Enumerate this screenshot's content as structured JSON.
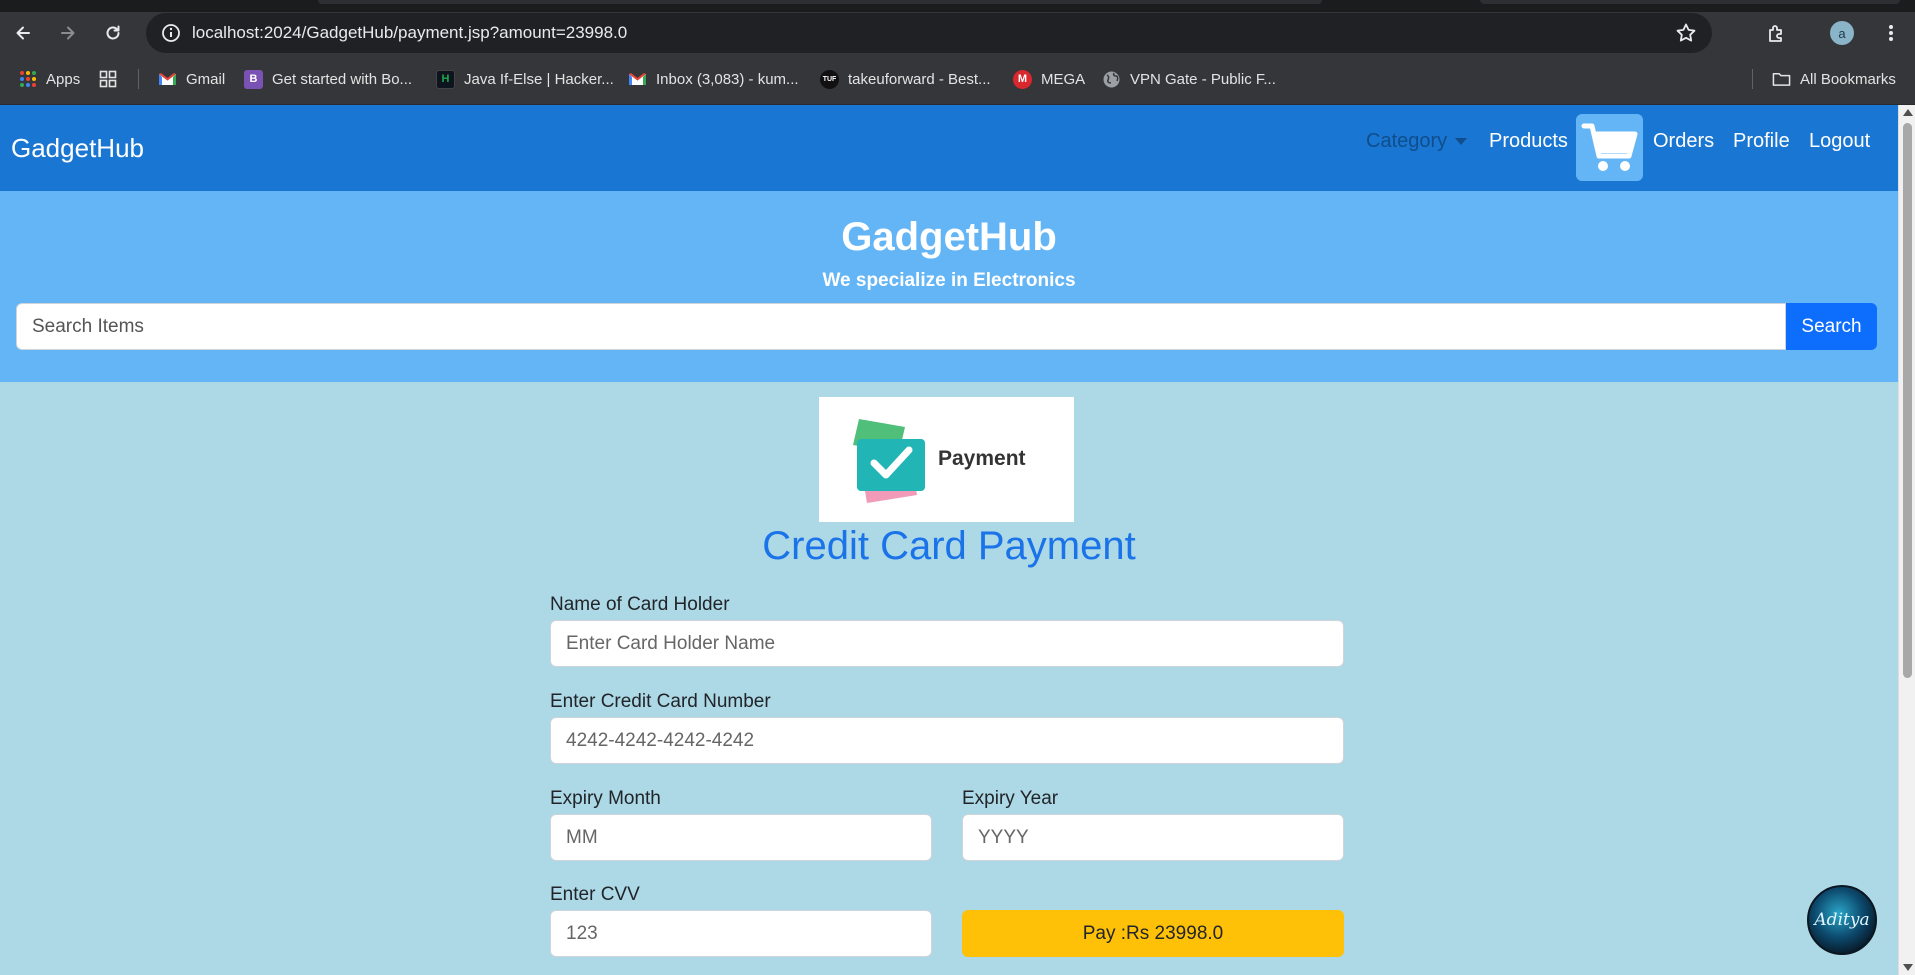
{
  "browser": {
    "url": "localhost:2024/GadgetHub/payment.jsp?amount=23998.0",
    "profile_initial": "a",
    "bookmarks": [
      {
        "label": "Apps",
        "icon": "apps-grid-icon"
      },
      {
        "label": "Gmail",
        "icon": "gmail-icon"
      },
      {
        "label": "Get started with Bo...",
        "icon": "bootstrap-icon"
      },
      {
        "label": "Java If-Else | Hacker...",
        "icon": "hackerrank-icon"
      },
      {
        "label": "Inbox (3,083) - kum...",
        "icon": "gmail-icon"
      },
      {
        "label": "takeuforward - Best...",
        "icon": "tuf-icon"
      },
      {
        "label": "MEGA",
        "icon": "mega-icon"
      },
      {
        "label": "VPN Gate - Public F...",
        "icon": "globe-icon"
      }
    ],
    "all_bookmarks": "All Bookmarks"
  },
  "navbar": {
    "brand": "GadgetHub",
    "category": "Category",
    "products": "Products",
    "orders": "Orders",
    "profile": "Profile",
    "logout": "Logout"
  },
  "hero": {
    "title": "GadgetHub",
    "subtitle": "We specialize in Electronics",
    "search_placeholder": "Search Items",
    "search_button": "Search"
  },
  "payment": {
    "logo_text": "Payment",
    "title": "Credit Card Payment",
    "holder_label": "Name of Card Holder",
    "holder_placeholder": "Enter Card Holder Name",
    "card_label": "Enter Credit Card Number",
    "card_placeholder": "4242-4242-4242-4242",
    "month_label": "Expiry Month",
    "month_placeholder": "MM",
    "year_label": "Expiry Year",
    "year_placeholder": "YYYY",
    "cvv_label": "Enter CVV",
    "cvv_placeholder": "123",
    "pay_button": "Pay :Rs 23998.0"
  },
  "chat_avatar": "Aditya",
  "colors": {
    "navbar": "#1976d2",
    "hero": "#64b5f6",
    "page_bg": "#add8e6",
    "search_button": "#0d6efd",
    "title": "#1a73e8",
    "pay_button": "#ffc107"
  }
}
